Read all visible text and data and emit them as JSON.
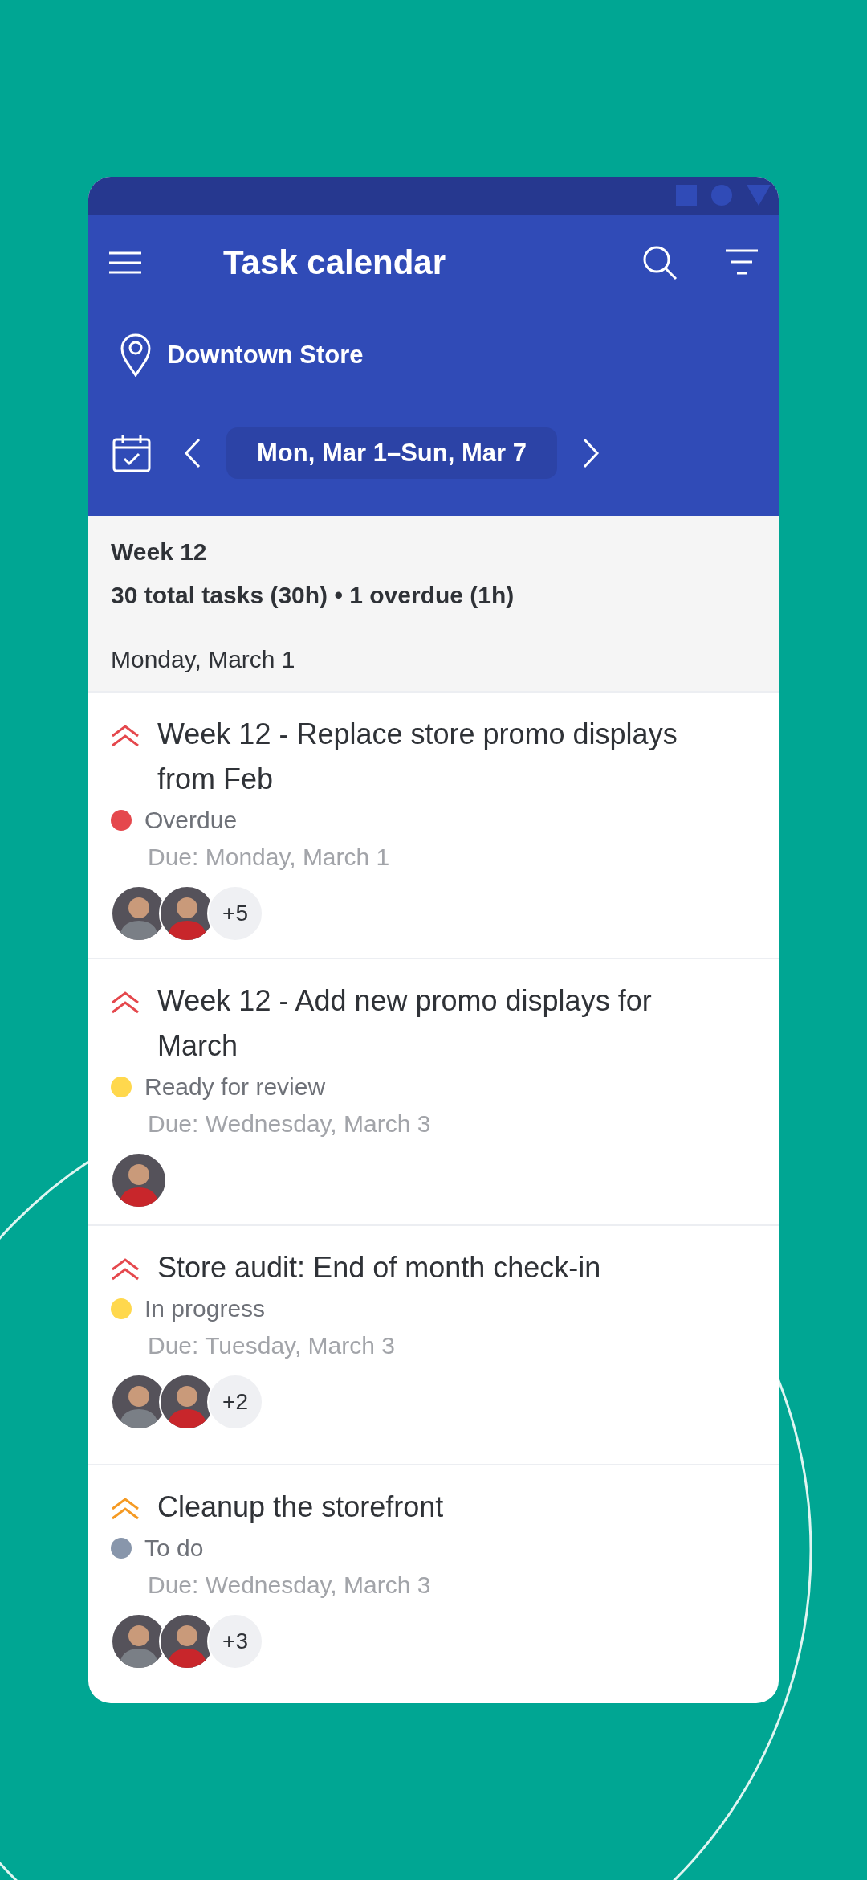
{
  "app_bar": {
    "title": "Task calendar",
    "location": "Downtown Store",
    "date_range": "Mon, Mar 1–Sun, Mar 7"
  },
  "summary": {
    "week": "Week 12",
    "totals": "30 total tasks (30h) • 1 overdue (1h)",
    "day": "Monday, March 1"
  },
  "tasks": [
    {
      "title": "Week 12 - Replace store promo displays from Feb",
      "priority": {
        "color": "#e5484d"
      },
      "status": {
        "label": "Overdue",
        "color": "#e5484d"
      },
      "due": "Due: Monday, March 1",
      "assignees": [
        {
          "color": "#7a7f86"
        },
        {
          "color": "#c8262b"
        }
      ],
      "more": "+5"
    },
    {
      "title": "Week 12 - Add new promo displays for March",
      "priority": {
        "color": "#e5484d"
      },
      "status": {
        "label": "Ready for review",
        "color": "#ffd84d"
      },
      "due": "Due: Wednesday, March 3",
      "assignees": [
        {
          "color": "#c8262b"
        }
      ]
    },
    {
      "title": "Store audit: End of month check-in",
      "priority": {
        "color": "#e5484d"
      },
      "status": {
        "label": "In progress",
        "color": "#ffd84d"
      },
      "due": "Due: Tuesday, March 3",
      "assignees": [
        {
          "color": "#7a7f86"
        },
        {
          "color": "#c8262b"
        }
      ],
      "more": "+2"
    },
    {
      "title": "Cleanup the storefront",
      "priority": {
        "color": "#f59a23"
      },
      "status": {
        "label": "To do",
        "color": "#8896ab"
      },
      "due": "Due: Wednesday, March 3",
      "assignees": [
        {
          "color": "#7a7f86"
        },
        {
          "color": "#c8262b"
        }
      ],
      "more": "+3"
    }
  ]
}
